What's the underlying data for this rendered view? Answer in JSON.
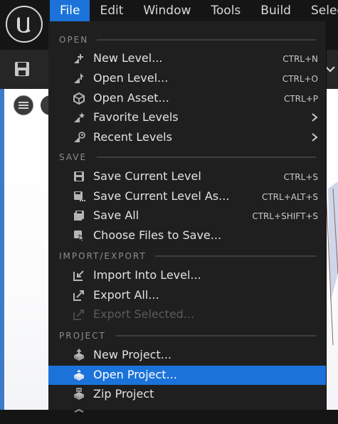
{
  "menubar": {
    "items": [
      "File",
      "Edit",
      "Window",
      "Tools",
      "Build",
      "Select"
    ],
    "active_index": 0
  },
  "colors": {
    "accent": "#1b73d9",
    "menu_bg": "#1f1f1f",
    "viewport_edge": "#3d7ac8"
  },
  "file_menu": {
    "sections": [
      {
        "label": "OPEN",
        "items": [
          {
            "label": "New Level...",
            "shortcut": "CTRL+N",
            "icon": "new-level-icon"
          },
          {
            "label": "Open Level...",
            "shortcut": "CTRL+O",
            "icon": "open-level-icon"
          },
          {
            "label": "Open Asset...",
            "shortcut": "CTRL+P",
            "icon": "open-asset-icon"
          },
          {
            "label": "Favorite Levels",
            "submenu": true,
            "icon": "favorite-levels-icon"
          },
          {
            "label": "Recent Levels",
            "submenu": true,
            "icon": "recent-levels-icon"
          }
        ]
      },
      {
        "label": "SAVE",
        "items": [
          {
            "label": "Save Current Level",
            "shortcut": "CTRL+S",
            "icon": "save-icon"
          },
          {
            "label": "Save Current Level As...",
            "shortcut": "CTRL+ALT+S",
            "icon": "save-as-icon"
          },
          {
            "label": "Save All",
            "shortcut": "CTRL+SHIFT+S",
            "icon": "save-all-icon"
          },
          {
            "label": "Choose Files to Save...",
            "icon": "choose-files-icon"
          }
        ]
      },
      {
        "label": "IMPORT/EXPORT",
        "items": [
          {
            "label": "Import Into Level...",
            "icon": "import-icon"
          },
          {
            "label": "Export All...",
            "icon": "export-icon"
          },
          {
            "label": "Export Selected...",
            "icon": "export-selected-icon",
            "disabled": true
          }
        ]
      },
      {
        "label": "PROJECT",
        "items": [
          {
            "label": "New Project...",
            "icon": "new-project-icon"
          },
          {
            "label": "Open Project...",
            "icon": "open-project-icon",
            "highlighted": true
          },
          {
            "label": "Zip Project",
            "icon": "zip-project-icon"
          }
        ]
      }
    ]
  }
}
